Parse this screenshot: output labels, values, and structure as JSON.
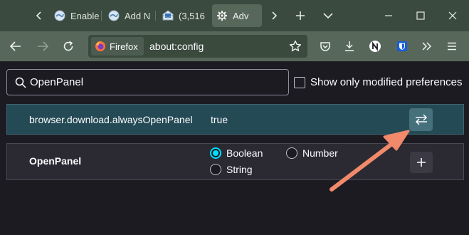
{
  "tabs": [
    {
      "title": "Enable",
      "favicon": "web-icon",
      "selected": false
    },
    {
      "title": "Add N",
      "favicon": "web-icon",
      "selected": false
    },
    {
      "title": "(3,516",
      "favicon": "inbox-icon",
      "selected": false
    },
    {
      "title": "Adv",
      "favicon": "gear-icon",
      "selected": true
    }
  ],
  "navbar": {
    "identity_label": "Firefox",
    "url": "about:config"
  },
  "search": {
    "value": "OpenPanel"
  },
  "modified_filter": {
    "label": "Show only modified preferences",
    "checked": false
  },
  "preference": {
    "name": "browser.download.alwaysOpenPanel",
    "value": "true"
  },
  "new_preference": {
    "name": "OpenPanel",
    "types": [
      {
        "label": "Boolean",
        "checked": true
      },
      {
        "label": "Number",
        "checked": false
      },
      {
        "label": "String",
        "checked": false
      }
    ]
  },
  "colors": {
    "accent": "#00ddff",
    "annotation_arrow": "#f08a6a",
    "highlight_row": "#244a55"
  }
}
